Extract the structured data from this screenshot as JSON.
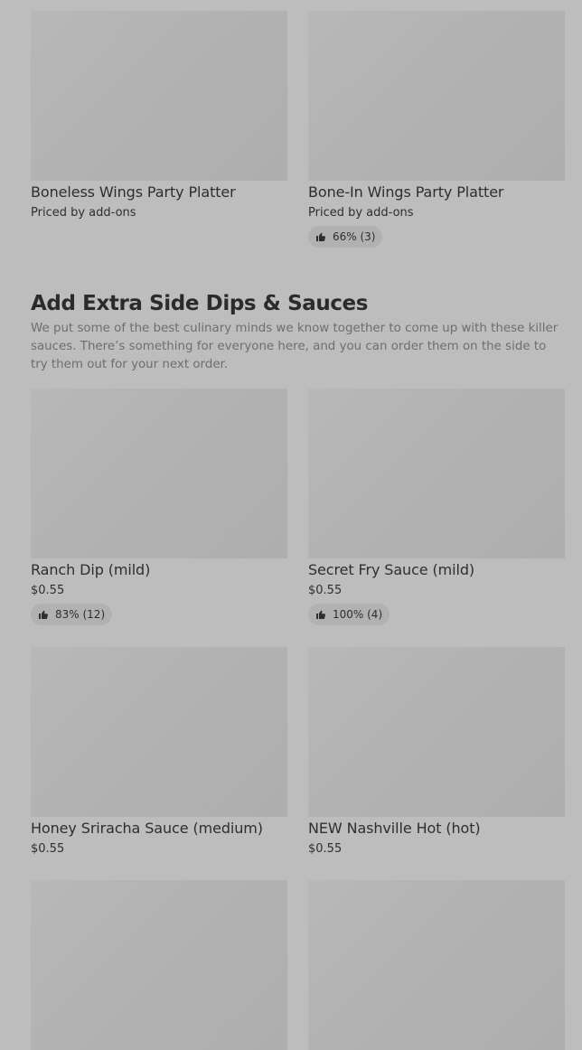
{
  "upper_items": [
    {
      "title": "Boneless Wings Party Platter",
      "price": "Priced by add-ons"
    },
    {
      "title": "Bone-In Wings Party Platter",
      "price": "Priced by add-ons",
      "rating": "66% (3)"
    }
  ],
  "section": {
    "title": "Add Extra Side Dips & Sauces",
    "description": "We put some of the best culinary minds we know together to come up with these killer sauces. There’s something for everyone here, and you can order them on the side to try them out for your next order."
  },
  "items": [
    {
      "title": "Ranch Dip (mild)",
      "price": "$0.55",
      "rating": "83% (12)"
    },
    {
      "title": "Secret Fry Sauce (mild)",
      "price": "$0.55",
      "rating": "100% (4)"
    },
    {
      "title": "Honey Sriracha Sauce (medium)",
      "price": "$0.55"
    },
    {
      "title": "NEW Nashville Hot (hot)",
      "price": "$0.55"
    }
  ],
  "icons": {
    "rating": "thumbs-up-icon"
  },
  "colors": {
    "background": "#bdbdbd",
    "placeholder": "#b1b1b1",
    "text": "#2e2e2e",
    "muted_text": "#6e6e6e"
  }
}
